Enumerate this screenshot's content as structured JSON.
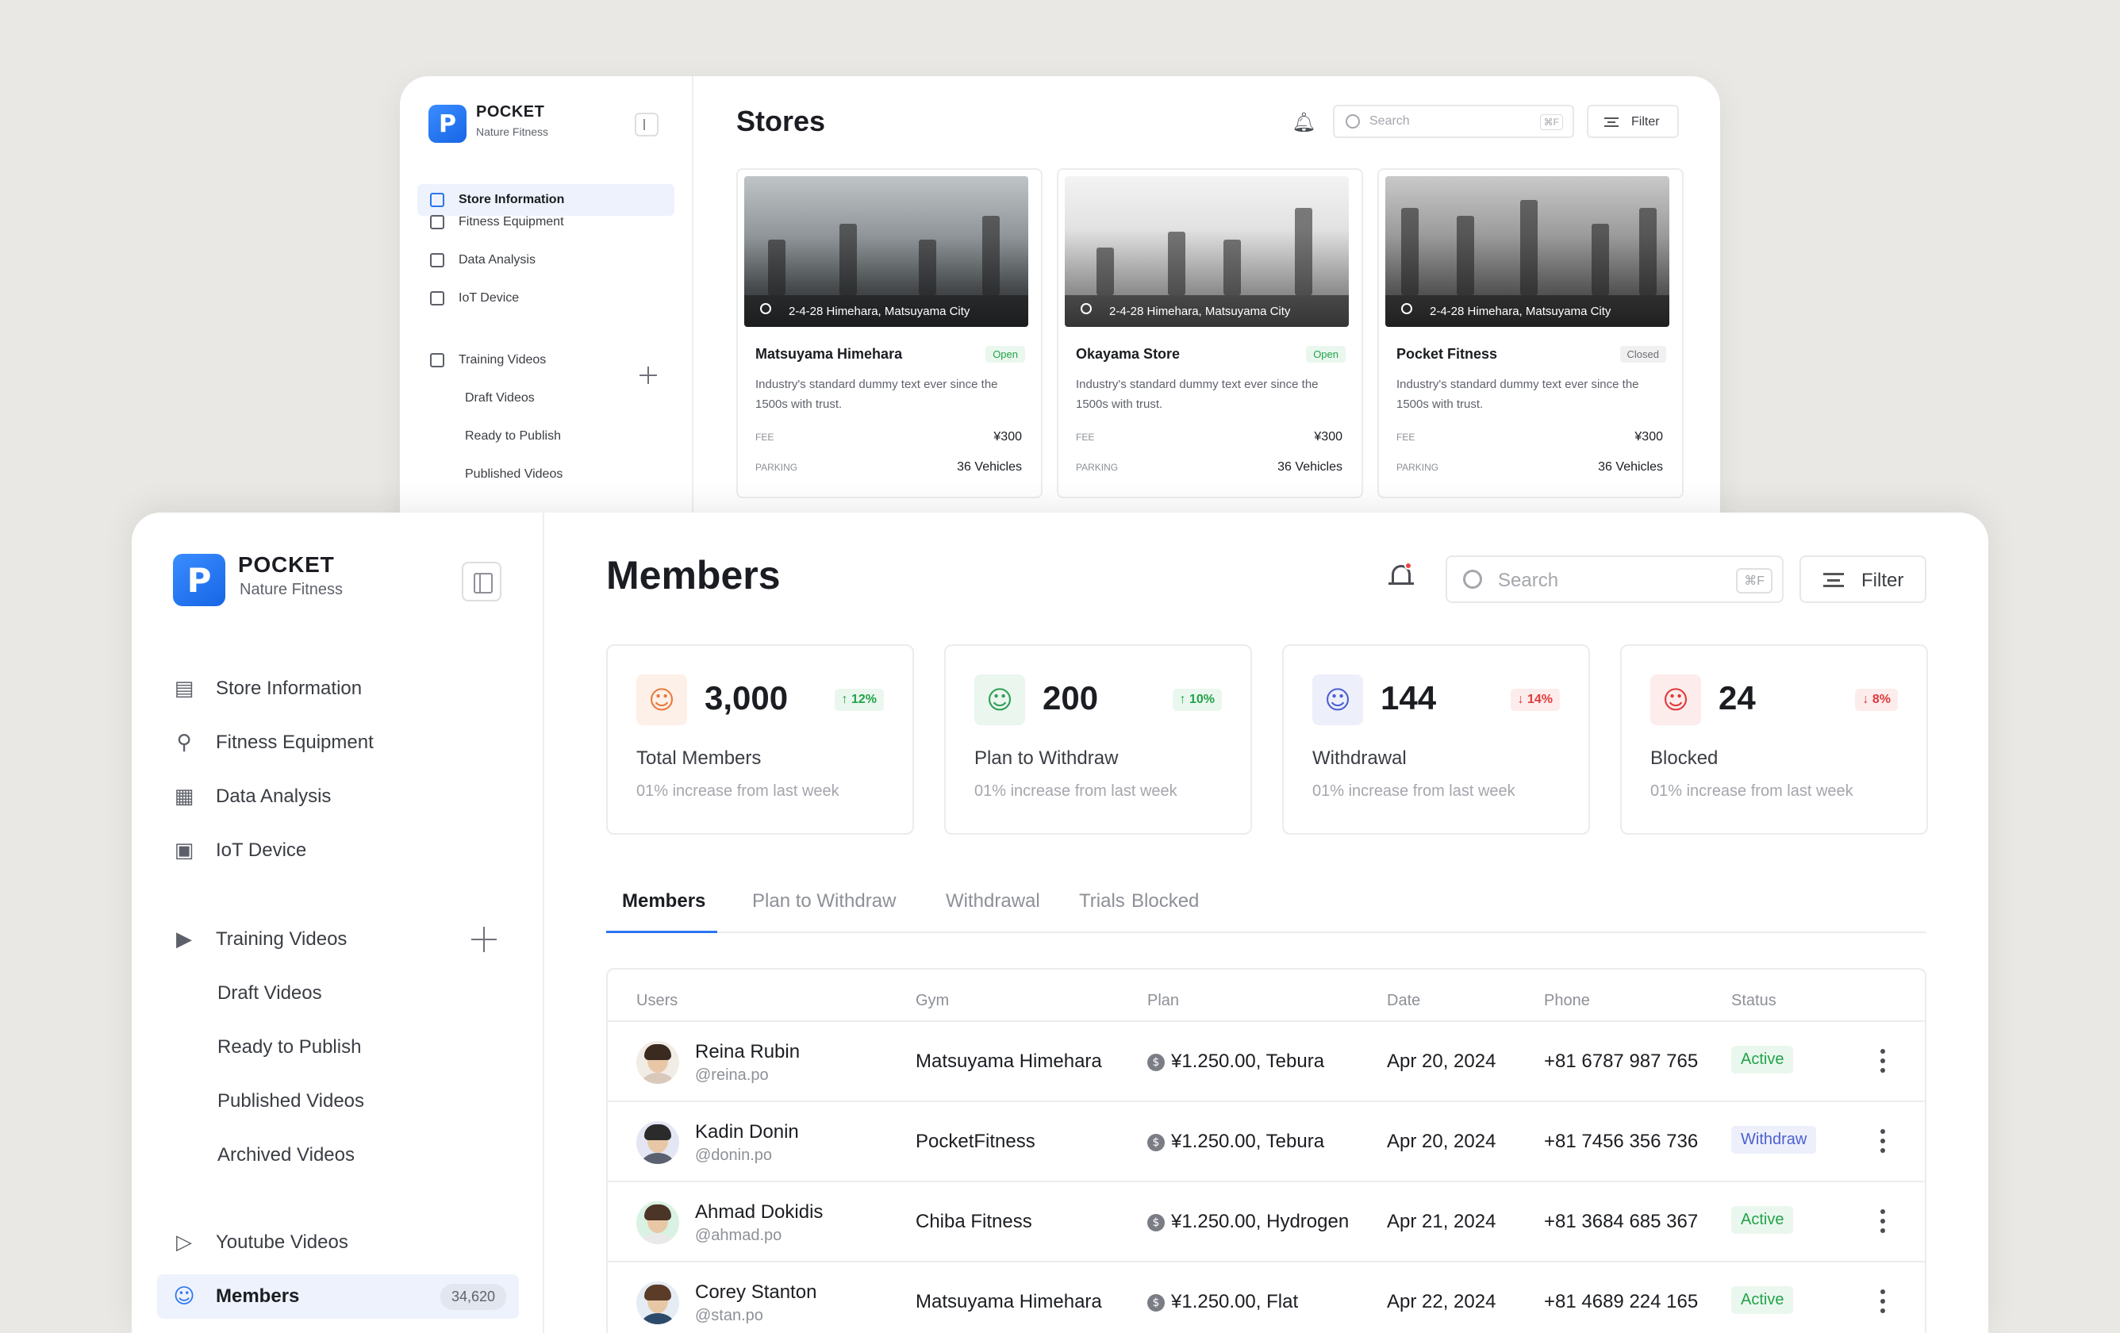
{
  "stores_window": {
    "brand": "POCKET",
    "brand_sub": "Nature Fitness",
    "logo_letter": "P",
    "title": "Stores",
    "search_placeholder": "Search",
    "search_shortcut": "⌘F",
    "filter_label": "Filter",
    "nav": [
      {
        "label": "Store Information",
        "icon": "store-icon",
        "active": true
      },
      {
        "label": "Fitness Equipment",
        "icon": "equipment-icon"
      },
      {
        "label": "Data Analysis",
        "icon": "chart-icon"
      },
      {
        "label": "IoT Device",
        "icon": "device-icon"
      },
      {
        "label": "Training Videos",
        "icon": "video-icon"
      },
      {
        "label": "Draft Videos"
      },
      {
        "label": "Ready to Publish"
      },
      {
        "label": "Published Videos"
      }
    ],
    "stores": [
      {
        "address": "2-4-28 Himehara, Matsuyama City",
        "name": "Matsuyama Himehara",
        "status": "Open",
        "desc": "Industry's standard dummy text ever since the 1500s with trust.",
        "fee_label": "FEE",
        "fee": "¥300",
        "parking_label": "PARKING",
        "parking": "36 Vehicles"
      },
      {
        "address": "2-4-28 Himehara, Matsuyama City",
        "name": "Okayama Store",
        "status": "Open",
        "desc": "Industry's standard dummy text ever since the 1500s with trust.",
        "fee_label": "FEE",
        "fee": "¥300",
        "parking_label": "PARKING",
        "parking": "36 Vehicles"
      },
      {
        "address": "2-4-28 Himehara, Matsuyama City",
        "name": "Pocket Fitness",
        "status": "Closed",
        "desc": "Industry's standard dummy text ever since the 1500s with trust.",
        "fee_label": "FEE",
        "fee": "¥300",
        "parking_label": "PARKING",
        "parking": "36 Vehicles"
      }
    ]
  },
  "members_window": {
    "brand": "POCKET",
    "brand_sub": "Nature Fitness",
    "logo_letter": "P",
    "title": "Members",
    "search_placeholder": "Search",
    "search_shortcut": "⌘F",
    "filter_label": "Filter",
    "nav": [
      {
        "label": "Store Information",
        "icon": "store-icon"
      },
      {
        "label": "Fitness Equipment",
        "icon": "equipment-icon"
      },
      {
        "label": "Data Analysis",
        "icon": "chart-icon"
      },
      {
        "label": "IoT Device",
        "icon": "device-icon"
      },
      {
        "label": "Training Videos",
        "icon": "video-icon"
      },
      {
        "label": "Draft Videos"
      },
      {
        "label": "Ready to Publish"
      },
      {
        "label": "Published Videos"
      },
      {
        "label": "Archived Videos"
      },
      {
        "label": "Youtube Videos",
        "icon": "youtube-icon"
      },
      {
        "label": "Members",
        "icon": "members-icon",
        "active": true,
        "count": "34,620"
      }
    ],
    "stats": [
      {
        "value": "3,000",
        "change": "↑ 12%",
        "direction": "up",
        "label": "Total Members",
        "sub": "01% increase from last week",
        "icon": "users-icon",
        "color": "#e97a3c",
        "bg": "#fdf0e8"
      },
      {
        "value": "200",
        "change": "↑ 10%",
        "direction": "up",
        "label": "Plan to Withdraw",
        "sub": "01% increase from last week",
        "icon": "user-clock-icon",
        "color": "#2f9e57",
        "bg": "#eaf6ee"
      },
      {
        "value": "144",
        "change": "↓ 14%",
        "direction": "down",
        "label": "Withdrawal",
        "sub": "01% increase from last week",
        "icon": "user-minus-icon",
        "color": "#4d5fd1",
        "bg": "#edf0fb"
      },
      {
        "value": "24",
        "change": "↓ 8%",
        "direction": "down",
        "label": "Blocked",
        "sub": "01% increase from last week",
        "icon": "user-x-icon",
        "color": "#e03a3a",
        "bg": "#fdecec"
      }
    ],
    "tabs": [
      "Members",
      "Plan to Withdraw",
      "Withdrawal",
      "Trials",
      "Blocked"
    ],
    "table": {
      "columns": [
        "Users",
        "Gym",
        "Plan",
        "Date",
        "Phone",
        "Status"
      ],
      "rows": [
        {
          "name": "Reina Rubin",
          "handle": "@reina.po",
          "gym": "Matsuyama Himehara",
          "plan": "¥1.250.00, Tebura",
          "date": "Apr 20, 2024",
          "phone": "+81 6787 987 765",
          "status": "Active"
        },
        {
          "name": "Kadin Donin",
          "handle": "@donin.po",
          "gym": "PocketFitness",
          "plan": "¥1.250.00, Tebura",
          "date": "Apr 20, 2024",
          "phone": "+81 7456 356 736",
          "status": "Withdraw"
        },
        {
          "name": "Ahmad Dokidis",
          "handle": "@ahmad.po",
          "gym": "Chiba Fitness",
          "plan": "¥1.250.00, Hydrogen",
          "date": "Apr 21, 2024",
          "phone": "+81 3684 685 367",
          "status": "Active"
        },
        {
          "name": "Corey Stanton",
          "handle": "@stan.po",
          "gym": "Matsuyama Himehara",
          "plan": "¥1.250.00, Flat",
          "date": "Apr 22, 2024",
          "phone": "+81 4689 224 165",
          "status": "Active"
        }
      ]
    }
  },
  "colors": {
    "accent": "#2b75f0",
    "active_green": "#22a348",
    "withdraw_blue": "#4d5fd1",
    "down_red": "#e03a3a",
    "background": "#e9e8e4"
  }
}
